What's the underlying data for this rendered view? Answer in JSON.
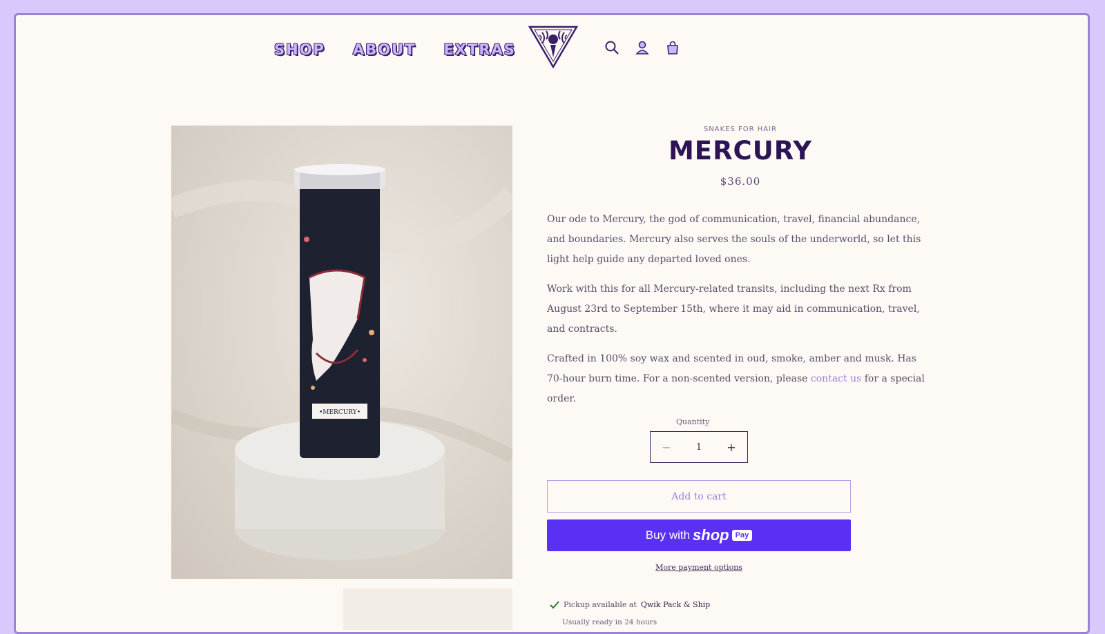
{
  "nav": {
    "items": [
      "Shop",
      "About",
      "Extras"
    ]
  },
  "header": {
    "icons": [
      "search-icon",
      "account-icon",
      "cart-icon"
    ]
  },
  "product": {
    "vendor": "SNAKES FOR HAIR",
    "title": "MERCURY",
    "price": "$36.00",
    "candle_label": "•MERCURY•",
    "description": [
      "Our ode to Mercury, the god of communication, travel, financial abundance, and boundaries. Mercury also serves the souls of the underworld, so let this light help guide any departed loved ones.",
      "Work with this for all Mercury-related transits, including the next Rx from August 23rd to September 15th, where it may aid in communication, travel, and contracts."
    ],
    "description3_pre": "Crafted in 100% soy wax and scented in oud, smoke, amber and musk. Has 70-hour burn time. For a non-scented version, please ",
    "description3_link": "contact us",
    "description3_post": " for a special order.",
    "quantity_label": "Quantity",
    "quantity_value": "1",
    "minus": "−",
    "plus": "+",
    "add_to_cart": "Add to cart",
    "buy_with": "Buy with",
    "shop_word": "shop",
    "pay_word": "Pay",
    "more_payment": "More payment options",
    "pickup_prefix": "Pickup available at",
    "pickup_location": "Qwik Pack & Ship",
    "ready_text": "Usually ready in 24 hours"
  },
  "colors": {
    "accent": "#9b7fe0",
    "title": "#2c1457",
    "shop_pay": "#5a31f4",
    "frame": "#d8c8fb"
  }
}
